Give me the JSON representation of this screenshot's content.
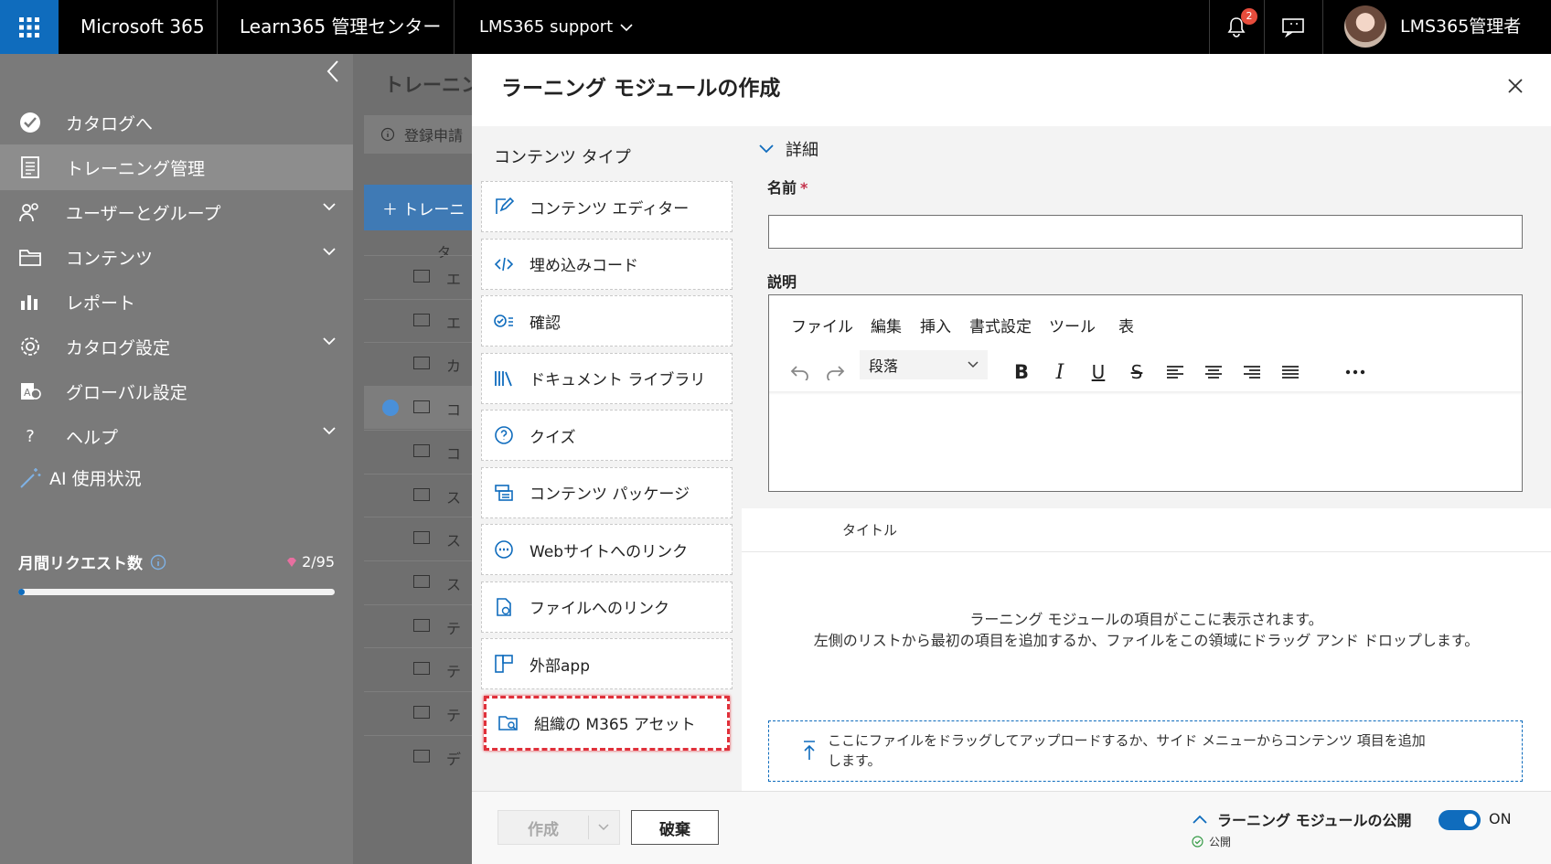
{
  "topbar": {
    "app_name": "Microsoft 365",
    "admin_center": "Learn365 管理センター",
    "tenant": "LMS365 support",
    "notification_count": "2",
    "user_name": "LMS365管理者"
  },
  "sidebar": {
    "items": [
      {
        "label": "カタログへ",
        "icon": "check-circle-icon"
      },
      {
        "label": "トレーニング管理",
        "icon": "document-icon"
      },
      {
        "label": "ユーザーとグループ",
        "icon": "people-icon"
      },
      {
        "label": "コンテンツ",
        "icon": "folder-icon"
      },
      {
        "label": "レポート",
        "icon": "bar-chart-icon"
      },
      {
        "label": "カタログ設定",
        "icon": "gear-icon"
      },
      {
        "label": "グローバル設定",
        "icon": "settings-icon"
      },
      {
        "label": "ヘルプ",
        "icon": "question-icon"
      }
    ],
    "ai_title": "AI 使用状況",
    "monthly_label": "月間リクエスト数",
    "usage_text": "2/95",
    "usage_fraction": 0.021
  },
  "background": {
    "title": "トレーニン",
    "info_text": "登録申請",
    "add_button": "＋ トレーニ",
    "col_header": "タ",
    "rows": [
      "エ",
      "エ",
      "カ",
      "コ",
      "コ",
      "ス",
      "ス",
      "ス",
      "テ",
      "テ",
      "テ",
      "デ"
    ]
  },
  "panel": {
    "title": "ラーニング モジュールの作成",
    "content_type_header": "コンテンツ タイプ",
    "content_types": [
      {
        "label": "コンテンツ エディター",
        "icon": "edit-icon"
      },
      {
        "label": "埋め込みコード",
        "icon": "code-icon"
      },
      {
        "label": "確認",
        "icon": "checklist-icon"
      },
      {
        "label": "ドキュメント ライブラリ",
        "icon": "library-icon"
      },
      {
        "label": "クイズ",
        "icon": "quiz-icon"
      },
      {
        "label": "コンテンツ パッケージ",
        "icon": "package-icon"
      },
      {
        "label": "Webサイトへのリンク",
        "icon": "link-icon"
      },
      {
        "label": "ファイルへのリンク",
        "icon": "file-link-icon"
      },
      {
        "label": "外部app",
        "icon": "app-icon"
      },
      {
        "label": "組織の M365 アセット",
        "icon": "m365-asset-icon"
      }
    ],
    "details_label": "詳細",
    "name_label": "名前",
    "required_mark": "*",
    "description_label": "説明",
    "editor_menu": [
      "ファイル",
      "編集",
      "挿入",
      "書式設定",
      "ツール",
      "表"
    ],
    "paragraph_select": "段落",
    "items_column_header": "タイトル",
    "empty_line1": "ラーニング モジュールの項目がここに表示されます。",
    "empty_line2": "左側のリストから最初の項目を追加するか、ファイルをこの領域にドラッグ アンド ドロップします。",
    "upload_line1": "ここにファイルをドラッグしてアップロードするか、サイド メニューからコンテンツ 項目を追加",
    "upload_line2": "します。",
    "create_button": "作成",
    "discard_button": "破棄",
    "publish_label": "ラーニング モジュールの公開",
    "publish_status": "公開",
    "toggle_text": "ON"
  },
  "colors": {
    "accent": "#0f6cbd",
    "highlight_border": "#e0303a",
    "sidebar_bg": "#7a7a7a"
  }
}
